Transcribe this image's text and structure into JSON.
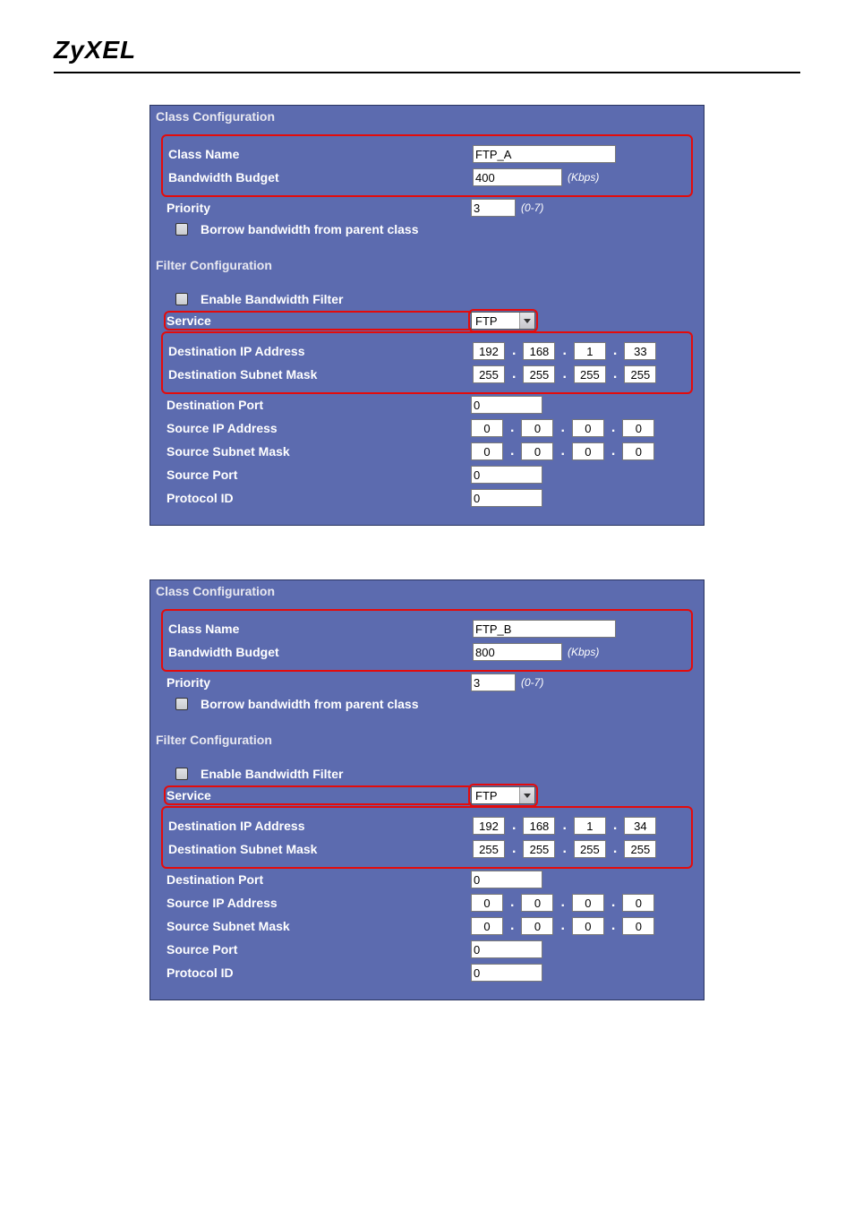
{
  "page": {
    "logo": "ZyXEL"
  },
  "panels": [
    {
      "classSection": {
        "title": "Class Configuration",
        "classNameLabel": "Class Name",
        "classNameValue": "FTP_A",
        "bwLabel": "Bandwidth Budget",
        "bwValue": "400",
        "bwUnit": "(Kbps)",
        "priorityLabel": "Priority",
        "priorityValue": "3",
        "priorityRange": "(0-7)",
        "borrowLabel": "Borrow bandwidth from parent class"
      },
      "filterSection": {
        "title": "Filter Configuration",
        "enableLabel": "Enable Bandwidth Filter",
        "serviceLabel": "Service",
        "serviceValue": "FTP",
        "dipLabel": "Destination IP Address",
        "dip": [
          "192",
          "168",
          "1",
          "33"
        ],
        "dmaskLabel": "Destination Subnet Mask",
        "dmask": [
          "255",
          "255",
          "255",
          "255"
        ],
        "dportLabel": "Destination Port",
        "dportValue": "0",
        "sipLabel": "Source IP Address",
        "sip": [
          "0",
          "0",
          "0",
          "0"
        ],
        "smaskLabel": "Source Subnet Mask",
        "smask": [
          "0",
          "0",
          "0",
          "0"
        ],
        "sportLabel": "Source Port",
        "sportValue": "0",
        "protoLabel": "Protocol ID",
        "protoValue": "0"
      }
    },
    {
      "classSection": {
        "title": "Class Configuration",
        "classNameLabel": "Class Name",
        "classNameValue": "FTP_B",
        "bwLabel": "Bandwidth Budget",
        "bwValue": "800",
        "bwUnit": "(Kbps)",
        "priorityLabel": "Priority",
        "priorityValue": "3",
        "priorityRange": "(0-7)",
        "borrowLabel": "Borrow bandwidth from parent class"
      },
      "filterSection": {
        "title": "Filter Configuration",
        "enableLabel": "Enable Bandwidth Filter",
        "serviceLabel": "Service",
        "serviceValue": "FTP",
        "dipLabel": "Destination IP Address",
        "dip": [
          "192",
          "168",
          "1",
          "34"
        ],
        "dmaskLabel": "Destination Subnet Mask",
        "dmask": [
          "255",
          "255",
          "255",
          "255"
        ],
        "dportLabel": "Destination Port",
        "dportValue": "0",
        "sipLabel": "Source IP Address",
        "sip": [
          "0",
          "0",
          "0",
          "0"
        ],
        "smaskLabel": "Source Subnet Mask",
        "smask": [
          "0",
          "0",
          "0",
          "0"
        ],
        "sportLabel": "Source Port",
        "sportValue": "0",
        "protoLabel": "Protocol ID",
        "protoValue": "0"
      }
    }
  ]
}
